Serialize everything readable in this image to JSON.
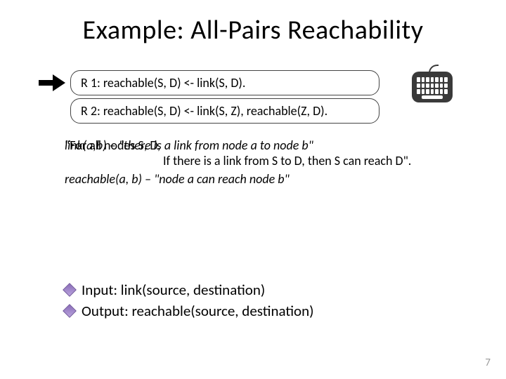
{
  "title": "Example: All-Pairs Reachability",
  "rules": {
    "r1": "R 1: reachable(S, D) <- link(S, D).",
    "r2": "R 2: reachable(S, D) <- link(S, Z), reachable(Z, D)."
  },
  "overlap": {
    "line1_layerA": "link(a,b) – \"there is a link from node a to node b\"",
    "line1_layerB": "\"For all nodes S, D,",
    "line2": "If there is a link from S to D, then S can reach D\".",
    "line3": "reachable(a, b) – \"node a can reach node b\""
  },
  "bullets": {
    "input": "Input: link(source, destination)",
    "output": "Output: reachable(source, destination)"
  },
  "page": "7"
}
